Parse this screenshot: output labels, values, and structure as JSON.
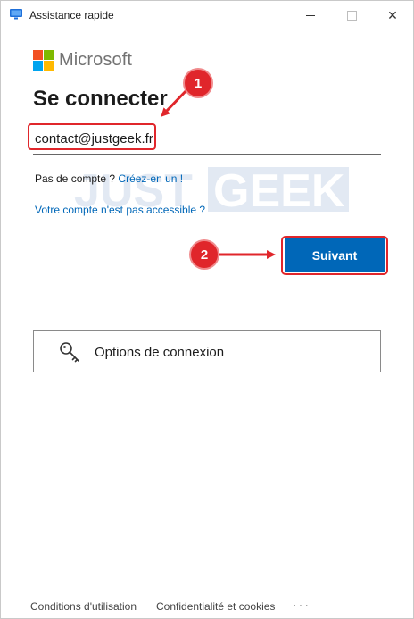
{
  "window": {
    "title": "Assistance rapide",
    "controls": {
      "minimize": "minimize",
      "maximize": "maximize",
      "close": "✕"
    }
  },
  "brand": {
    "name": "Microsoft",
    "colors": [
      "#f25022",
      "#7fba00",
      "#00a4ef",
      "#ffb900"
    ]
  },
  "signin": {
    "heading": "Se connecter",
    "email_value": "contact@justgeek.fr",
    "no_account_text": "Pas de compte ?",
    "create_link": "Créez-en un !",
    "inaccessible_link": "Votre compte n'est pas accessible ?",
    "next_button": "Suivant",
    "options_label": "Options de connexion"
  },
  "annotations": {
    "badge_1": "1",
    "badge_2": "2",
    "accent_color": "#e0262b"
  },
  "watermark": "JUSTGEEK",
  "footer": {
    "terms": "Conditions d'utilisation",
    "privacy": "Confidentialité et cookies",
    "more": "···"
  }
}
